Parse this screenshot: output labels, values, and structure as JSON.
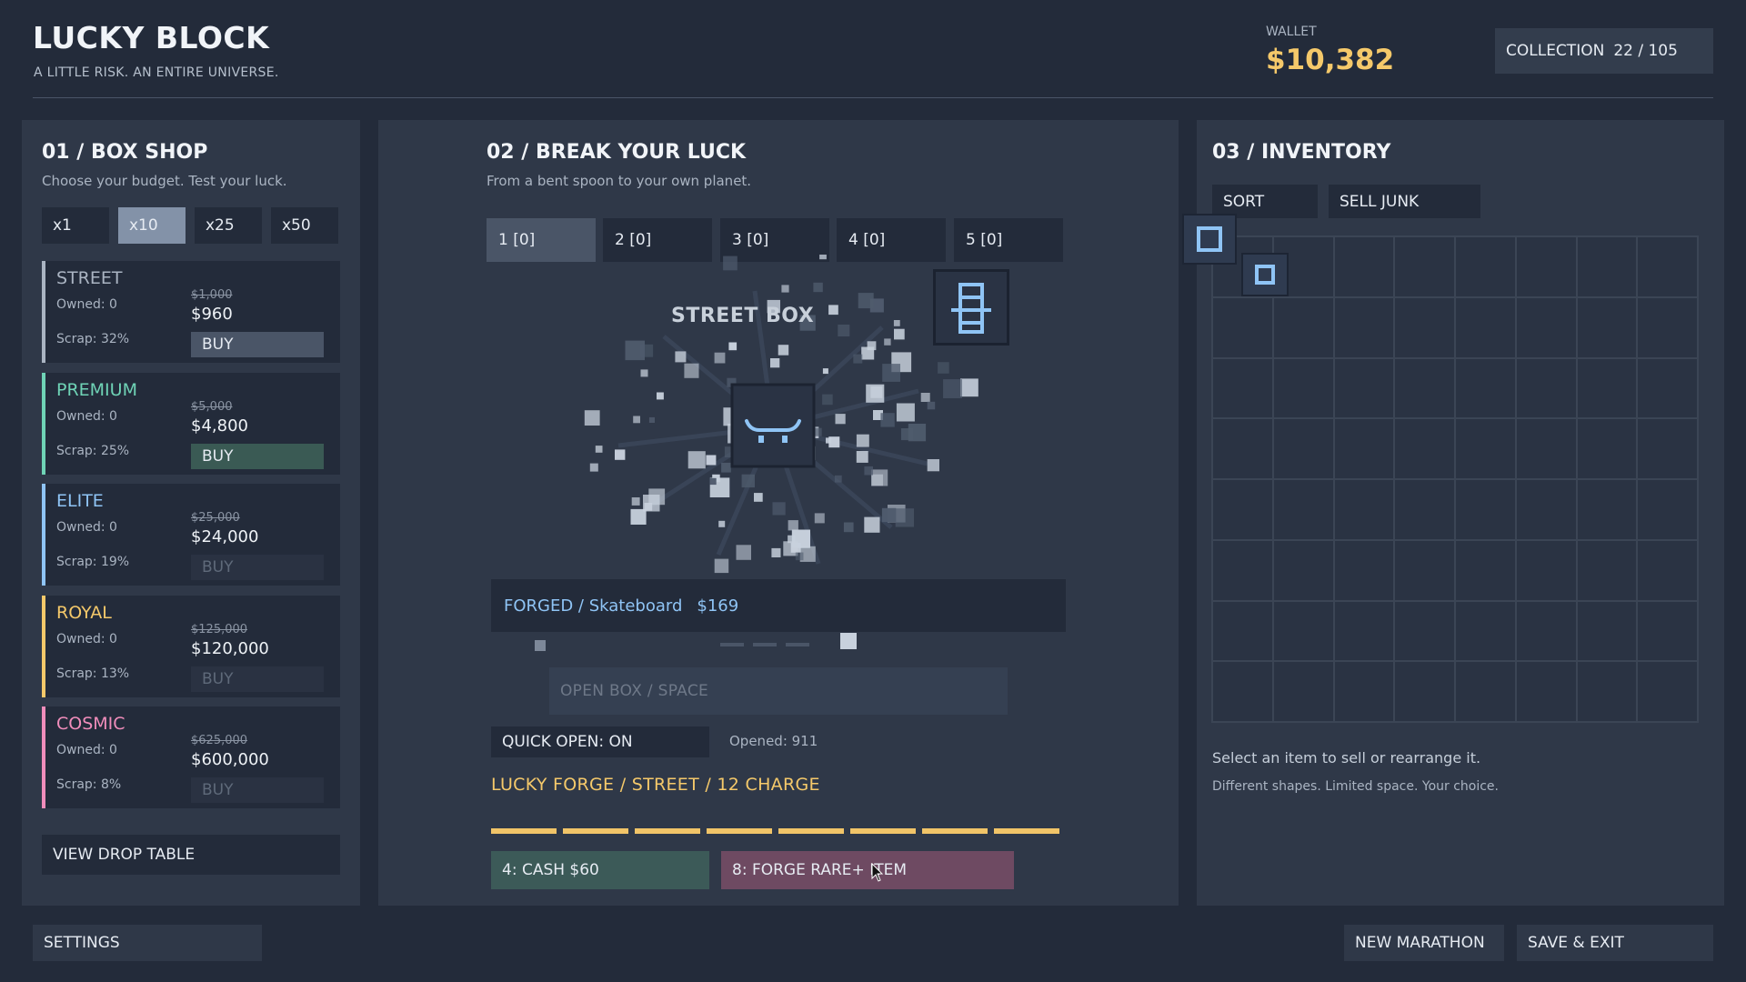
{
  "header": {
    "title": "LUCKY BLOCK",
    "tagline": "A LITTLE RISK. AN ENTIRE UNIVERSE.",
    "wallet_label": "WALLET",
    "wallet_value": "$10,382",
    "collection_label": "COLLECTION",
    "collection_value": "22 / 105"
  },
  "shop": {
    "title": "01 / BOX SHOP",
    "subtitle": "Choose your budget. Test your luck.",
    "multipliers": [
      "x1",
      "x10",
      "x25",
      "x50"
    ],
    "active_multiplier": "x10",
    "boxes": [
      {
        "name": "STREET",
        "owned": "Owned: 0",
        "scrap": "Scrap: 32%",
        "old_price": "$1,000",
        "price": "$960",
        "buy": "BUY",
        "color": "#aab4c2",
        "state": "normal"
      },
      {
        "name": "PREMIUM",
        "owned": "Owned: 0",
        "scrap": "Scrap: 25%",
        "old_price": "$5,000",
        "price": "$4,800",
        "buy": "BUY",
        "color": "#6fd3b6",
        "state": "green"
      },
      {
        "name": "ELITE",
        "owned": "Owned: 0",
        "scrap": "Scrap: 19%",
        "old_price": "$25,000",
        "price": "$24,000",
        "buy": "BUY",
        "color": "#8fc4f5",
        "state": "disabled"
      },
      {
        "name": "ROYAL",
        "owned": "Owned: 0",
        "scrap": "Scrap: 13%",
        "old_price": "$125,000",
        "price": "$120,000",
        "buy": "BUY",
        "color": "#f5c96a",
        "state": "disabled"
      },
      {
        "name": "COSMIC",
        "owned": "Owned: 0",
        "scrap": "Scrap: 8%",
        "old_price": "$625,000",
        "price": "$600,000",
        "buy": "BUY",
        "color": "#f08dbb",
        "state": "disabled"
      }
    ],
    "drop_table": "VIEW DROP TABLE"
  },
  "break": {
    "title": "02 / BREAK YOUR LUCK",
    "subtitle": "From a bent spoon to your own planet.",
    "slots": [
      "1  [0]",
      "2  [0]",
      "3  [0]",
      "4  [0]",
      "5  [0]"
    ],
    "active_slot": 0,
    "box_label": "STREET BOX",
    "result_text": "FORGED / Skateboard",
    "result_price": "$169",
    "open_button": "OPEN BOX  /  SPACE",
    "quick_open": "QUICK OPEN: ON",
    "opened": "Opened: 911",
    "forge_label": "LUCKY FORGE / STREET / 12 CHARGE",
    "charge_segments": 8,
    "reward_cash": "4: CASH $60",
    "reward_forge": "8: FORGE RARE+ ITEM"
  },
  "inventory": {
    "title": "03 / INVENTORY",
    "sort": "SORT",
    "sell_junk": "SELL JUNK",
    "grid_size": 8,
    "hint": "Select an item to sell or rearrange it.",
    "hint2": "Different shapes. Limited space. Your choice."
  },
  "footer": {
    "settings": "SETTINGS",
    "new_marathon": "NEW MARATHON",
    "save_exit": "SAVE & EXIT"
  },
  "icons": {
    "skateboard": "skateboard-icon",
    "ladder": "ladder-icon",
    "item_square": "square-item-icon"
  }
}
